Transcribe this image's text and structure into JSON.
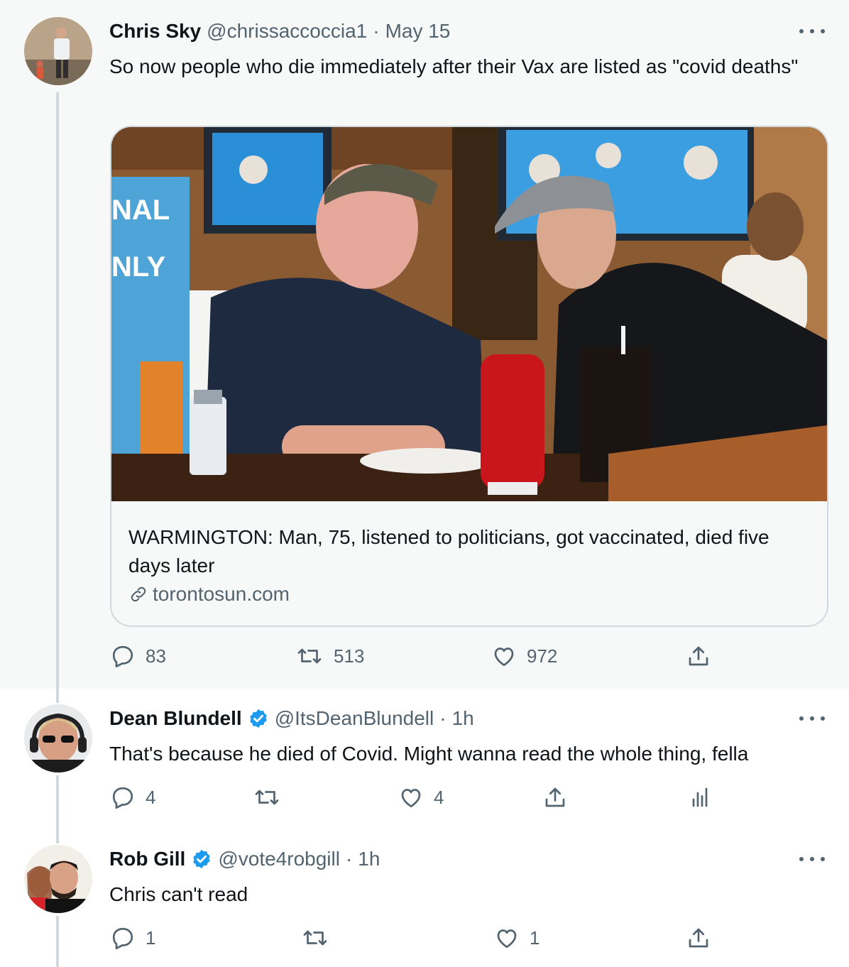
{
  "tweet": {
    "name": "Chris Sky",
    "handle": "@chrissaccoccia1",
    "separator": "·",
    "date": "May 15",
    "text": "So now people who die immediately after their Vax are listed as \"covid deaths\"",
    "card": {
      "title": "WARMINGTON: Man, 75, listened to politicians, got vaccinated, died five days later",
      "domain": "torontosun.com"
    },
    "replies": "83",
    "retweets": "513",
    "likes": "972"
  },
  "replies": [
    {
      "name": "Dean Blundell",
      "verified": true,
      "handle": "@ItsDeanBlundell",
      "separator": "·",
      "time": "1h",
      "text": "That's because he died of Covid.  Might wanna read the whole thing, fella",
      "replies": "4",
      "retweets": "",
      "likes": "4"
    },
    {
      "name": "Rob Gill",
      "verified": true,
      "handle": "@vote4robgill",
      "separator": "·",
      "time": "1h",
      "text": "Chris can't read",
      "replies": "1",
      "retweets": "",
      "likes": "1"
    }
  ],
  "icons": {
    "reply": "reply-icon",
    "retweet": "retweet-icon",
    "like": "heart-icon",
    "share": "share-icon",
    "analytics": "analytics-icon",
    "more": "more-icon",
    "verified": "verified-badge-icon",
    "link": "link-icon"
  },
  "colors": {
    "verified": "#1d9bf0",
    "secondary_text": "#536471",
    "thread_line": "#cfd9de",
    "highlight_bg": "#f7f9f9"
  }
}
